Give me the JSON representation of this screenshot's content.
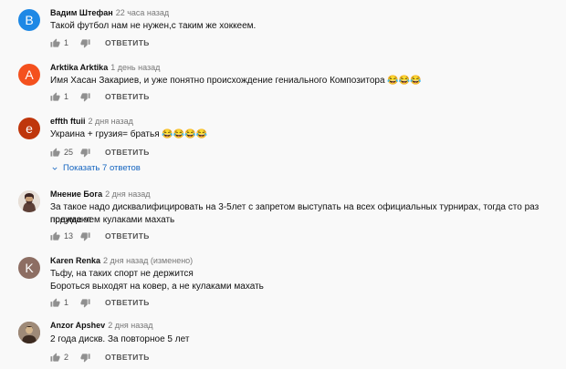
{
  "comments": [
    {
      "initial": "B",
      "color": "#1e88e5",
      "author": "Вадим Штефан",
      "time": "22 часа назад",
      "text": "Такой футбол нам не нужен,с таким же хоккеем.",
      "likes": "1",
      "reply": "ОТВЕТИТЬ"
    },
    {
      "initial": "A",
      "color": "#f4511e",
      "author": "Arktika Arktika",
      "time": "1 день назад",
      "text": "Имя Хасан Закариев, и уже понятно происхождение гениального Композитора 😂😂😂",
      "likes": "1",
      "reply": "ОТВЕТИТЬ"
    },
    {
      "initial": "e",
      "color": "#bf360c",
      "author": "effth ftuii",
      "time": "2 дня назад",
      "text": "Украина + грузия= братья 😂😂😂😂",
      "likes": "25",
      "reply": "ОТВЕТИТЬ",
      "replies_label": "Показать 7 ответов"
    },
    {
      "initial": "",
      "color": "#8d6e63",
      "author": "Мнение Бога",
      "time": "2 дня назад",
      "text": "За такое надо дисквалифицировать на 3-5лет с запретом выступать на всех официальных турнирах, тогда сто раз подумают",
      "text2": "прежде чем кулаками махать",
      "likes": "13",
      "reply": "ОТВЕТИТЬ"
    },
    {
      "initial": "K",
      "color": "#8d6e63",
      "author": "Karen Renka",
      "time": "2 дня назад (изменено)",
      "text": "Тьфу, на таких спорт не держится",
      "text2": "Бороться выходят на ковер, а не кулаками махать",
      "likes": "1",
      "reply": "ОТВЕТИТЬ"
    },
    {
      "initial": "",
      "color": "#6d4c41",
      "author": "Anzor Apshev",
      "time": "2 дня назад",
      "text": "2 года дискв. За повторное 5 лет",
      "likes": "2",
      "reply": "ОТВЕТИТЬ"
    }
  ]
}
